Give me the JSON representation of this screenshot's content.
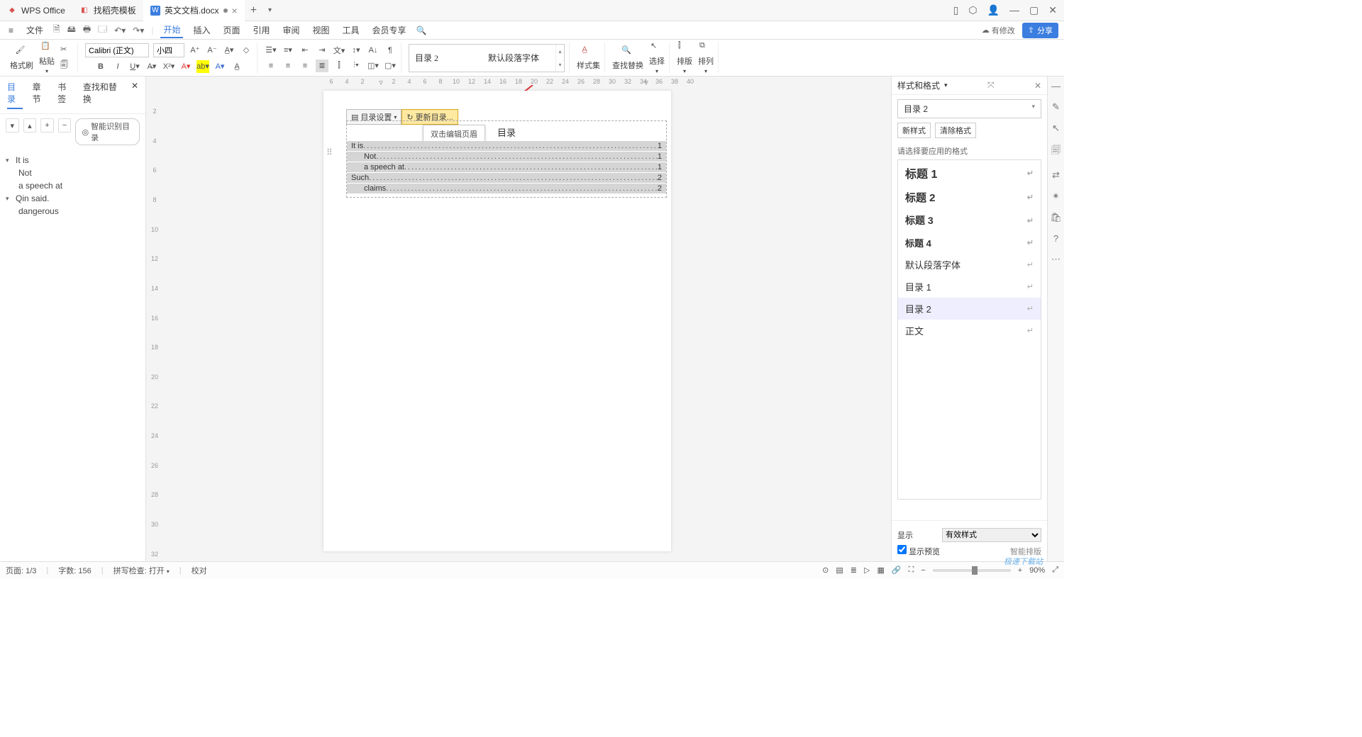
{
  "tabs": {
    "app": "WPS Office",
    "t1": "找稻壳模板",
    "t2": "英文文档.docx"
  },
  "menu": {
    "file": "文件",
    "items": [
      "开始",
      "插入",
      "页面",
      "引用",
      "审阅",
      "视图",
      "工具",
      "会员专享"
    ],
    "pending": "有修改",
    "share": "分享"
  },
  "ribbon": {
    "formatBrush": "格式刷",
    "paste": "粘贴",
    "font": "Calibri (正文)",
    "size": "小四",
    "styleName": "目录 2",
    "styleFont": "默认段落字体",
    "styleSet": "样式集",
    "findReplace": "查找替换",
    "select": "选择",
    "layout": "排版",
    "arrange": "排列"
  },
  "leftpane": {
    "tabs": [
      "目录",
      "章节",
      "书签",
      "查找和替换"
    ],
    "smart": "智能识别目录",
    "outline": [
      {
        "label": "It is",
        "children": [
          "Not",
          "a speech at"
        ]
      },
      {
        "label": "Qin said.",
        "children": [
          "dangerous"
        ]
      }
    ]
  },
  "rulerH": [
    "6",
    "4",
    "2",
    "",
    "2",
    "4",
    "6",
    "8",
    "10",
    "12",
    "14",
    "16",
    "18",
    "20",
    "22",
    "24",
    "26",
    "28",
    "30",
    "32",
    "34",
    "36",
    "38",
    "40"
  ],
  "rulerV": [
    "",
    "2",
    "",
    "4",
    "",
    "6",
    "",
    "8",
    "",
    "10",
    "",
    "12",
    "",
    "14",
    "",
    "16",
    "",
    "18",
    "",
    "20",
    "",
    "22",
    "",
    "24",
    "",
    "26",
    "",
    "28",
    "",
    "30",
    "",
    "32"
  ],
  "toc": {
    "settings": "目录设置",
    "update": "更新目录...",
    "title": "目录",
    "tooltip": "双击编辑页眉",
    "lines": [
      {
        "text": "It is",
        "page": "1",
        "indent": false
      },
      {
        "text": "Not",
        "page": "1",
        "indent": true
      },
      {
        "text": "a speech at",
        "page": "1",
        "indent": true
      },
      {
        "text": "Such",
        "page": "2",
        "indent": false
      },
      {
        "text": "claims",
        "page": "2",
        "indent": true
      }
    ]
  },
  "stylesPanel": {
    "title": "样式和格式",
    "current": "目录 2",
    "newStyle": "新样式",
    "clear": "清除格式",
    "hint": "请选择要应用的格式",
    "list": [
      {
        "label": "标题 1",
        "cls": "h1"
      },
      {
        "label": "标题 2",
        "cls": "h2"
      },
      {
        "label": "标题 3",
        "cls": "h3"
      },
      {
        "label": "标题 4",
        "cls": "h4"
      },
      {
        "label": "默认段落字体",
        "cls": ""
      },
      {
        "label": "目录 1",
        "cls": ""
      },
      {
        "label": "目录 2",
        "cls": "sel"
      },
      {
        "label": "正文",
        "cls": ""
      }
    ],
    "displayLabel": "显示",
    "displaySel": "有效样式",
    "preview": "显示预览",
    "smartLayout": "智能排版"
  },
  "status": {
    "page": "页面: 1/3",
    "words": "字数: 156",
    "spell": "拼写检查: 打开",
    "proof": "校对",
    "zoom": "90%"
  },
  "watermark": "极速下载站"
}
